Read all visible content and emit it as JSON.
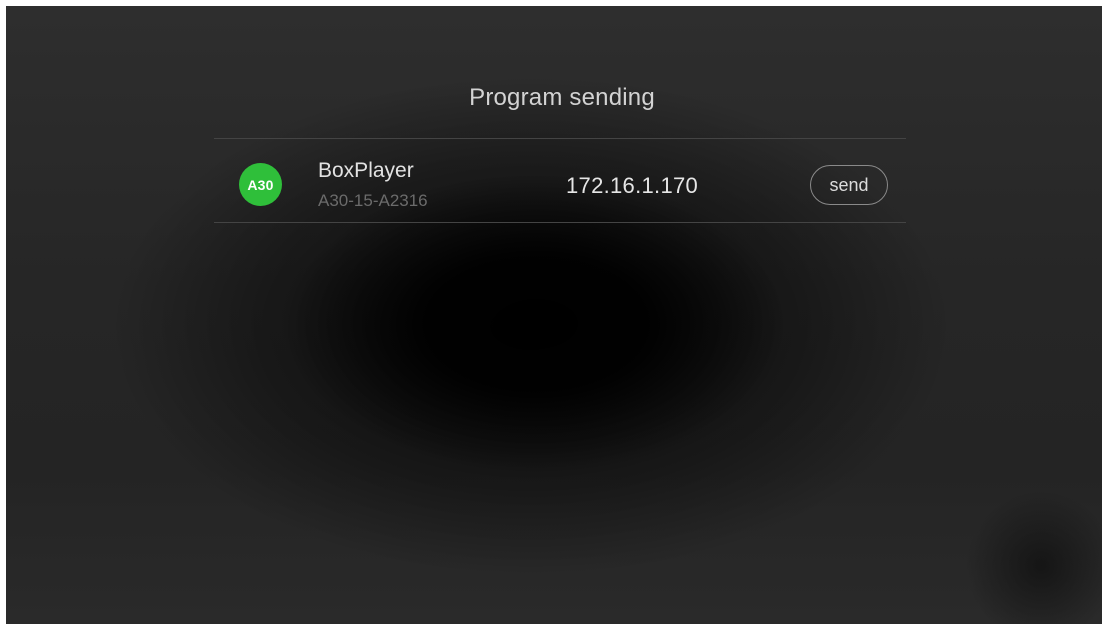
{
  "dialog": {
    "title": "Program sending"
  },
  "devices": [
    {
      "badge": "A30",
      "badge_color": "#2fbf3a",
      "name": "BoxPlayer",
      "model_id": "A30-15-A2316",
      "ip": "172.16.1.170",
      "action_label": "send"
    }
  ]
}
